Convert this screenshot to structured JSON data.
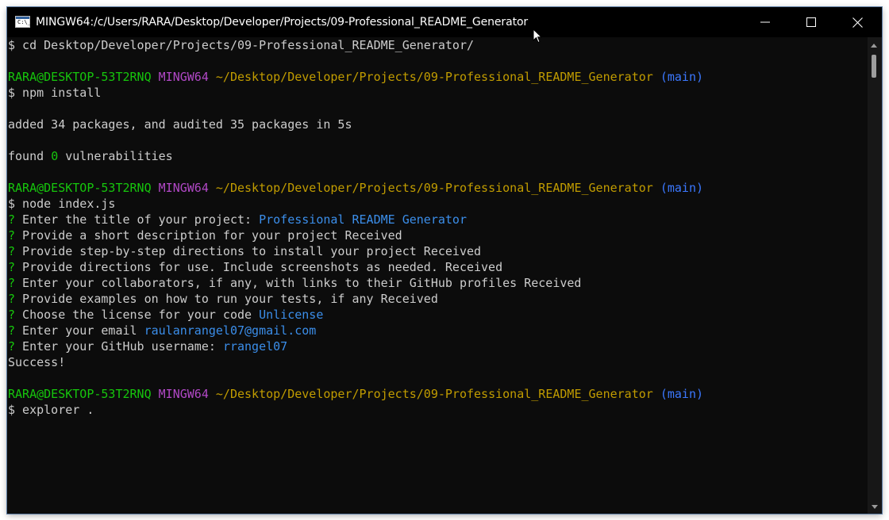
{
  "window": {
    "title": "MINGW64:/c/Users/RARA/Desktop/Developer/Projects/09-Professional_README_Generator",
    "icon_label": "C:\\_"
  },
  "colors": {
    "background": "#0c0c0c",
    "text": "#cccccc",
    "prompt_user": "#16c60c",
    "prompt_env": "#b148c6",
    "prompt_path": "#c19c00",
    "branch": "#3b78ff",
    "answer": "#3b8eea",
    "question_mark": "#16c60c"
  },
  "terminal": {
    "lines": [
      [
        {
          "t": "$ cd Desktop/Developer/Projects/09-Professional_README_Generator/",
          "c": "white"
        }
      ],
      [],
      [
        {
          "t": "RARA@DESKTOP-53T2RNQ",
          "c": "green"
        },
        {
          "t": " ",
          "c": "white"
        },
        {
          "t": "MINGW64",
          "c": "purple"
        },
        {
          "t": " ",
          "c": "white"
        },
        {
          "t": "~/Desktop/Developer/Projects/09-Professional_README_Generator",
          "c": "yellow"
        },
        {
          "t": " ",
          "c": "white"
        },
        {
          "t": "(main)",
          "c": "cyan"
        }
      ],
      [
        {
          "t": "$ npm install",
          "c": "white"
        }
      ],
      [],
      [
        {
          "t": "added 34 packages, and audited 35 packages in 5s",
          "c": "white"
        }
      ],
      [],
      [
        {
          "t": "found ",
          "c": "white"
        },
        {
          "t": "0",
          "c": "green"
        },
        {
          "t": " vulnerabilities",
          "c": "white"
        }
      ],
      [],
      [
        {
          "t": "RARA@DESKTOP-53T2RNQ",
          "c": "green"
        },
        {
          "t": " ",
          "c": "white"
        },
        {
          "t": "MINGW64",
          "c": "purple"
        },
        {
          "t": " ",
          "c": "white"
        },
        {
          "t": "~/Desktop/Developer/Projects/09-Professional_README_Generator",
          "c": "yellow"
        },
        {
          "t": " ",
          "c": "white"
        },
        {
          "t": "(main)",
          "c": "cyan"
        }
      ],
      [
        {
          "t": "$ node index.js",
          "c": "white"
        }
      ],
      [
        {
          "t": "?",
          "c": "green"
        },
        {
          "t": " Enter the title of your project: ",
          "c": "white"
        },
        {
          "t": "Professional README Generator",
          "c": "blue"
        }
      ],
      [
        {
          "t": "?",
          "c": "green"
        },
        {
          "t": " Provide a short description for your project Received",
          "c": "white"
        }
      ],
      [
        {
          "t": "?",
          "c": "green"
        },
        {
          "t": " Provide step-by-step directions to install your project Received",
          "c": "white"
        }
      ],
      [
        {
          "t": "?",
          "c": "green"
        },
        {
          "t": " Provide directions for use. Include screenshots as needed. Received",
          "c": "white"
        }
      ],
      [
        {
          "t": "?",
          "c": "green"
        },
        {
          "t": " Enter your collaborators, if any, with links to their GitHub profiles Received",
          "c": "white"
        }
      ],
      [
        {
          "t": "?",
          "c": "green"
        },
        {
          "t": " Provide examples on how to run your tests, if any Received",
          "c": "white"
        }
      ],
      [
        {
          "t": "?",
          "c": "green"
        },
        {
          "t": " Choose the license for your code ",
          "c": "white"
        },
        {
          "t": "Unlicense",
          "c": "blue"
        }
      ],
      [
        {
          "t": "?",
          "c": "green"
        },
        {
          "t": " Enter your email ",
          "c": "white"
        },
        {
          "t": "raulanrangel07@gmail.com",
          "c": "blue"
        }
      ],
      [
        {
          "t": "?",
          "c": "green"
        },
        {
          "t": " Enter your GitHub username: ",
          "c": "white"
        },
        {
          "t": "rrangel07",
          "c": "blue"
        }
      ],
      [
        {
          "t": "Success!",
          "c": "white"
        }
      ],
      [],
      [
        {
          "t": "RARA@DESKTOP-53T2RNQ",
          "c": "green"
        },
        {
          "t": " ",
          "c": "white"
        },
        {
          "t": "MINGW64",
          "c": "purple"
        },
        {
          "t": " ",
          "c": "white"
        },
        {
          "t": "~/Desktop/Developer/Projects/09-Professional_README_Generator",
          "c": "yellow"
        },
        {
          "t": " ",
          "c": "white"
        },
        {
          "t": "(main)",
          "c": "cyan"
        }
      ],
      [
        {
          "t": "$ explorer .",
          "c": "white"
        }
      ]
    ]
  },
  "controls": {
    "minimize_icon": "minimize-icon",
    "maximize_icon": "maximize-icon",
    "close_icon": "close-icon"
  }
}
